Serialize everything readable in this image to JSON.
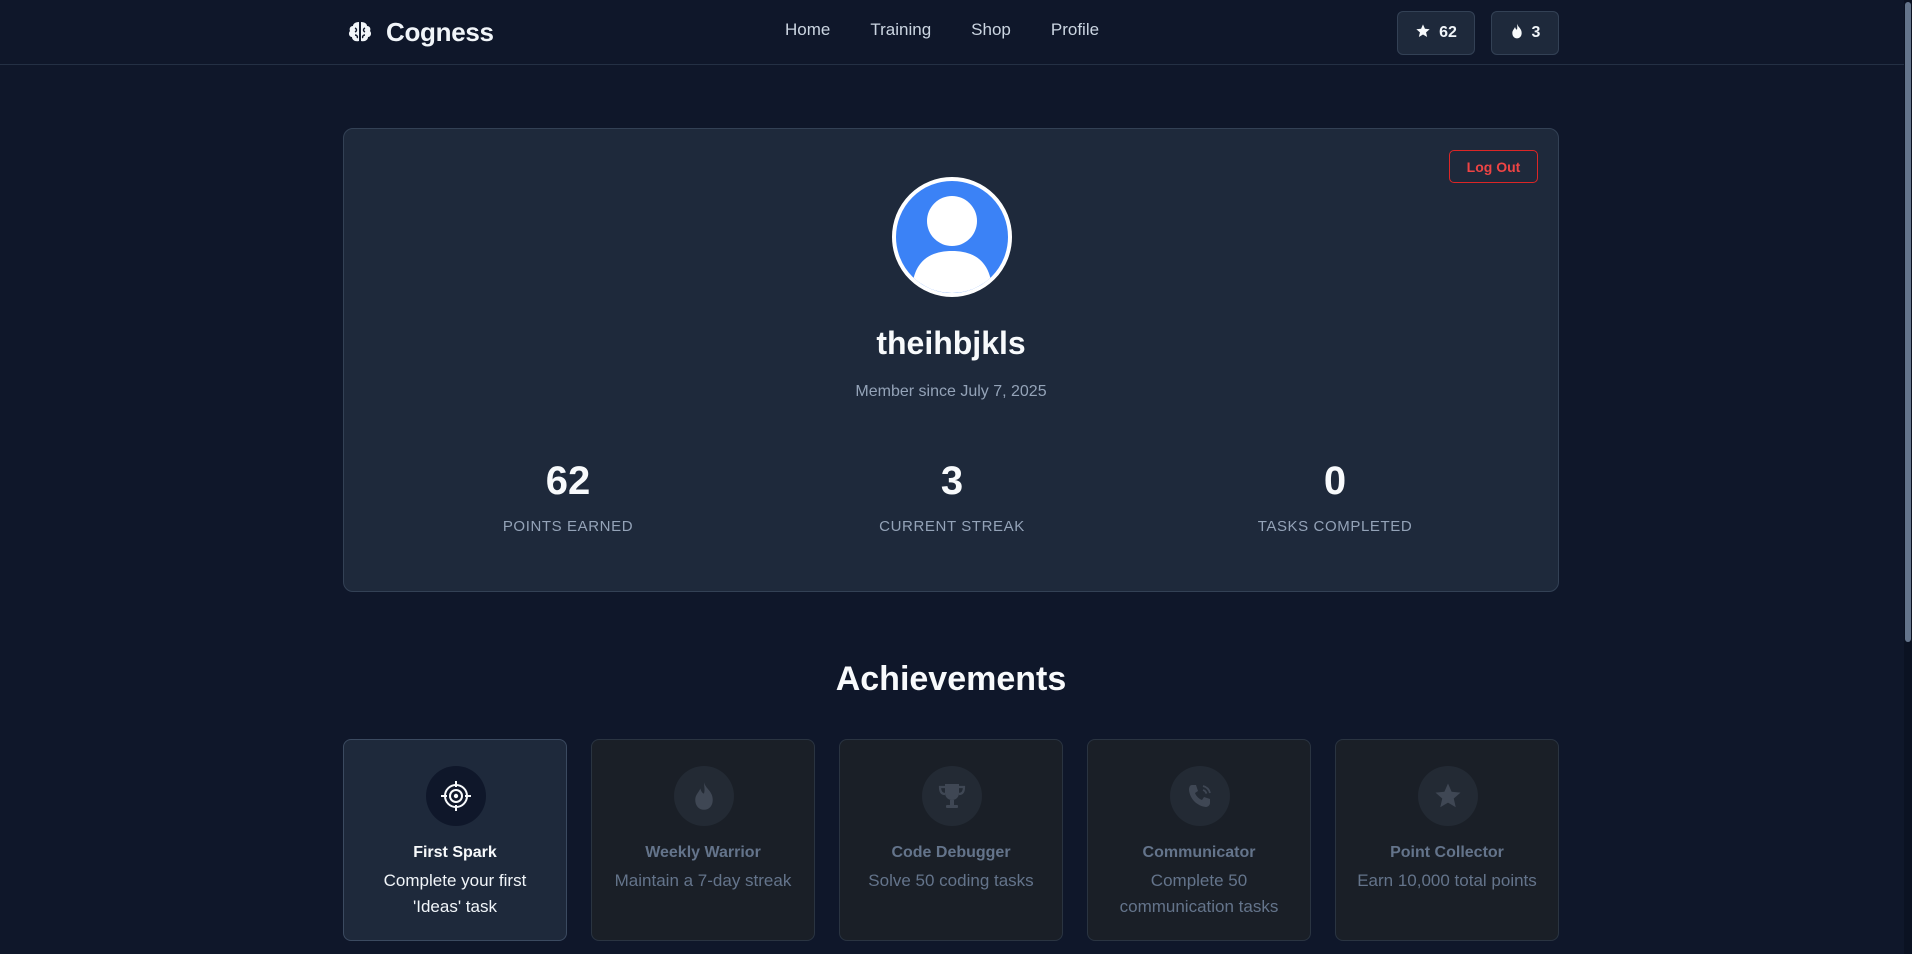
{
  "header": {
    "brand": "Cogness",
    "brand_icon": "brain-icon",
    "nav": [
      "Home",
      "Training",
      "Shop",
      "Profile"
    ],
    "points_badge": "62",
    "streak_badge": "3"
  },
  "profile": {
    "logout_label": "Log Out",
    "username": "theihbjkls",
    "member_since": "Member since July 7, 2025",
    "stats": [
      {
        "value": "62",
        "label": "POINTS EARNED"
      },
      {
        "value": "3",
        "label": "CURRENT STREAK"
      },
      {
        "value": "0",
        "label": "TASKS COMPLETED"
      }
    ]
  },
  "achievements": {
    "title": "Achievements",
    "items": [
      {
        "name": "First Spark",
        "desc": "Complete your first 'Ideas' task",
        "icon": "target-icon",
        "unlocked": true
      },
      {
        "name": "Weekly Warrior",
        "desc": "Maintain a 7-day streak",
        "icon": "flame-icon",
        "unlocked": false
      },
      {
        "name": "Code Debugger",
        "desc": "Solve 50 coding tasks",
        "icon": "trophy-icon",
        "unlocked": false
      },
      {
        "name": "Communicator",
        "desc": "Complete 50 communication tasks",
        "icon": "phone-icon",
        "unlocked": false
      },
      {
        "name": "Point Collector",
        "desc": "Earn 10,000 total points",
        "icon": "star-icon",
        "unlocked": false
      }
    ]
  },
  "colors": {
    "background": "#0f172a",
    "card": "#1e293b",
    "accent_blue": "#3b82f6",
    "logout_red": "#ef4444"
  }
}
